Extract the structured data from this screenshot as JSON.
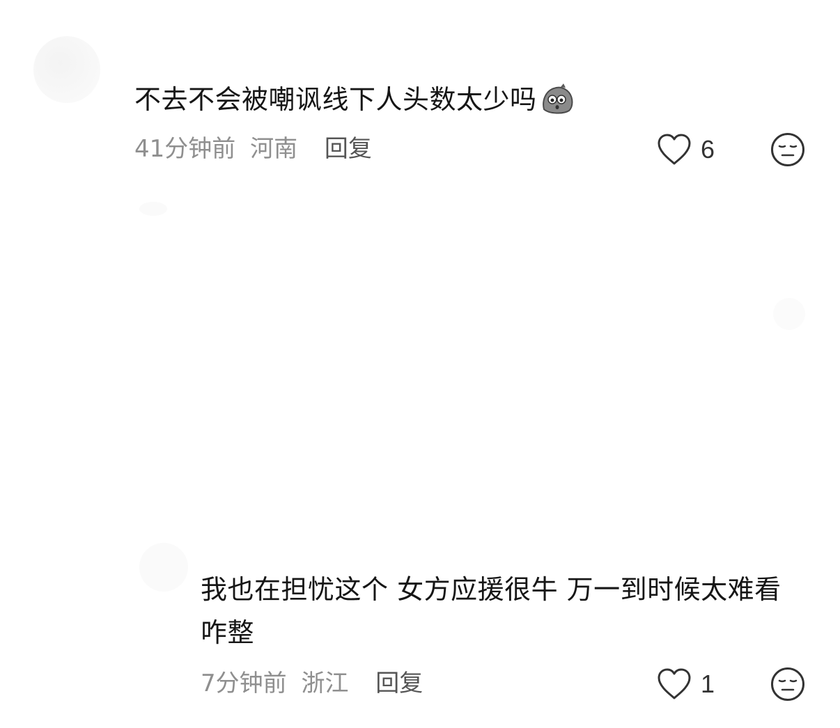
{
  "comments": [
    {
      "text": "不去不会被嘲讽线下人头数太少吗",
      "sticker": "surprised-rock-sticker",
      "time": "41分钟前",
      "location": "河南",
      "reply_label": "回复",
      "likes": "6"
    },
    {
      "text": "我也在担忧这个 女方应援很牛 万一到时候太难看咋整",
      "time": "7分钟前",
      "location": "浙江",
      "reply_label": "回复",
      "likes": "1"
    }
  ],
  "icons": {
    "like": "heart-outline-icon",
    "dislike": "unamused-face-icon"
  },
  "colors": {
    "text": "#161616",
    "meta": "#8f8f8f",
    "reply": "#555555",
    "icon_stroke": "#333333"
  }
}
